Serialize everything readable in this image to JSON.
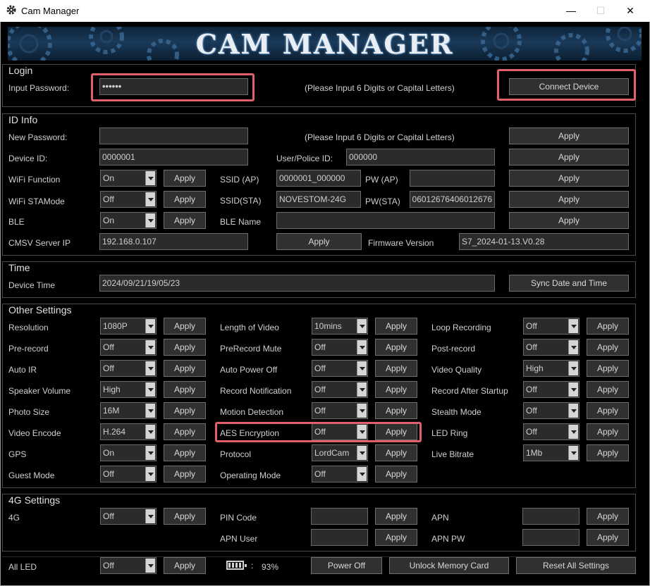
{
  "window": {
    "title": "Cam Manager",
    "minimize": "—",
    "maximize": "☐",
    "close": "✕"
  },
  "banner": {
    "title": "CAM MANAGER"
  },
  "login": {
    "title": "Login",
    "password_label": "Input Password:",
    "password_value": "••••••",
    "hint": "(Please Input 6 Digits or Capital Letters)",
    "connect_label": "Connect Device"
  },
  "id_info": {
    "title": "ID Info",
    "new_password_label": "New Password:",
    "new_password_value": "",
    "hint": "(Please Input 6 Digits or Capital Letters)",
    "device_id_label": "Device ID:",
    "device_id_value": "0000001",
    "user_police_id_label": "User/Police ID:",
    "user_police_id_value": "000000",
    "wifi_function_label": "WiFi Function",
    "wifi_function_value": "On",
    "ssid_ap_label": "SSID (AP)",
    "ssid_ap_value": "0000001_000000",
    "pw_ap_label": "PW (AP)",
    "pw_ap_value": "",
    "wifi_sta_label": "WiFi STAMode",
    "wifi_sta_value": "Off",
    "ssid_sta_label": "SSID(STA)",
    "ssid_sta_value": "NOVESTOM-24G",
    "pw_sta_label": "PW(STA)",
    "pw_sta_value": "06012676406012676",
    "ble_label": "BLE",
    "ble_value": "On",
    "ble_name_label": "BLE Name",
    "ble_name_value": "",
    "cmsv_label": "CMSV Server IP",
    "cmsv_value": "192.168.0.107",
    "firmware_label": "Firmware Version",
    "firmware_value": "S7_2024-01-13.V0.28"
  },
  "time": {
    "title": "Time",
    "device_time_label": "Device Time",
    "device_time_value": "2024/09/21/19/05/23",
    "sync_label": "Sync Date and Time"
  },
  "other": {
    "title": "Other Settings",
    "col1": [
      {
        "label": "Resolution",
        "value": "1080P"
      },
      {
        "label": "Pre-record",
        "value": "Off"
      },
      {
        "label": "Auto IR",
        "value": "Off"
      },
      {
        "label": "Speaker Volume",
        "value": "High"
      },
      {
        "label": "Photo Size",
        "value": "16M"
      },
      {
        "label": "Video Encode",
        "value": "H.264"
      },
      {
        "label": "GPS",
        "value": "On"
      },
      {
        "label": "Guest Mode",
        "value": "Off"
      }
    ],
    "col2": [
      {
        "label": "Length of Video",
        "value": "10mins"
      },
      {
        "label": "PreRecord Mute",
        "value": "Off"
      },
      {
        "label": "Auto Power Off",
        "value": "Off"
      },
      {
        "label": "Record Notification",
        "value": "Off"
      },
      {
        "label": "Motion Detection",
        "value": "Off"
      },
      {
        "label": "AES Encryption",
        "value": "Off"
      },
      {
        "label": "Protocol",
        "value": "LordCam"
      },
      {
        "label": "Operating Mode",
        "value": "Off"
      }
    ],
    "col3": [
      {
        "label": "Loop Recording",
        "value": "Off"
      },
      {
        "label": "Post-record",
        "value": "Off"
      },
      {
        "label": "Video Quality",
        "value": "High"
      },
      {
        "label": "Record After Startup",
        "value": "Off"
      },
      {
        "label": "Stealth Mode",
        "value": "Off"
      },
      {
        "label": "LED Ring",
        "value": "Off"
      },
      {
        "label": "Live Bitrate",
        "value": "1Mb"
      }
    ]
  },
  "g4": {
    "title": "4G Settings",
    "g4_label": "4G",
    "g4_value": "Off",
    "pin_label": "PIN Code",
    "pin_value": "",
    "apn_label": "APN",
    "apn_value": "",
    "apn_user_label": "APN User",
    "apn_user_value": "",
    "apn_pw_label": "APN PW",
    "apn_pw_value": ""
  },
  "bottom": {
    "all_led_label": "All LED",
    "all_led_value": "Off",
    "battery_colon": ":",
    "battery_percent": "93%",
    "power_off_label": "Power Off",
    "unlock_label": "Unlock Memory Card",
    "reset_label": "Reset All Settings"
  },
  "apply_label": "Apply",
  "colors": {
    "highlight": "#e0606c",
    "background": "#000000"
  }
}
